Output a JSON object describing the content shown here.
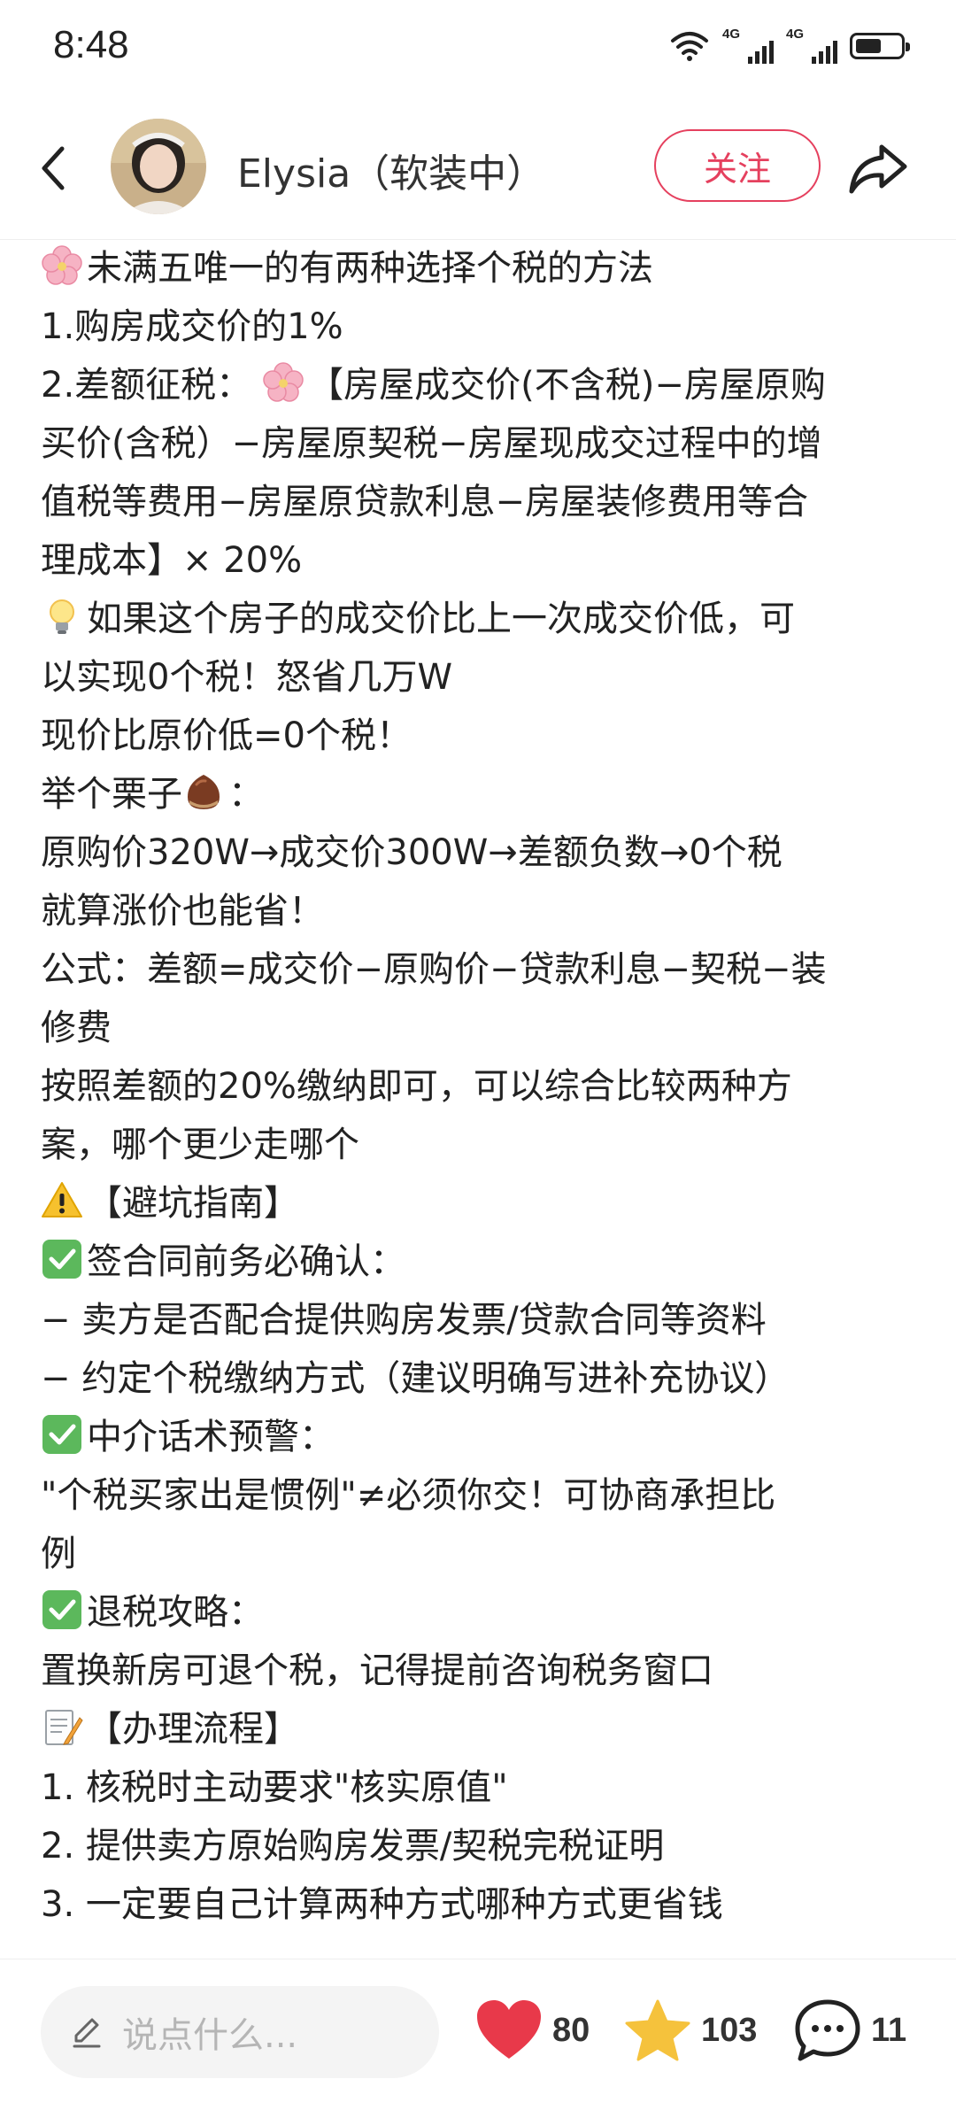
{
  "status_bar": {
    "time": "8:48",
    "signal_1": "4G",
    "signal_2": "4G"
  },
  "header": {
    "author_name": "Elysia（软装中）",
    "follow_label": "关注"
  },
  "content": {
    "lines": [
      "未满五唯一的有两种选择个税的方法",
      "1.购房成交价的1%",
      "2.差额征税：",
      "【房屋成交价(不含税)−房屋原购",
      "买价(含税）−房屋原契税−房屋现成交过程中的增",
      "值税等费用−房屋原贷款利息−房屋装修费用等合",
      "理成本】× 20%",
      "如果这个房子的成交价比上一次成交价低，可",
      "以实现0个税！怒省几万W",
      "现价比原价低=0个税！",
      "举个栗子",
      "：",
      "原购价320W→成交价300W→差额负数→0个税",
      "就算涨价也能省！",
      "公式：差额=成交价−原购价−贷款利息−契税−装",
      "修费",
      "按照差额的20%缴纳即可，可以综合比较两种方",
      "案，哪个更少走哪个",
      "【避坑指南】",
      "签合同前务必确认：",
      "− 卖方是否配合提供购房发票/贷款合同等资料",
      "− 约定个税缴纳方式（建议明确写进补充协议）",
      "中介话术预警：",
      "\"个税买家出是惯例\"≠必须你交！可协商承担比",
      "例",
      "退税攻略：",
      "置换新房可退个税，记得提前咨询税务窗口",
      "【办理流程】",
      "1. 核税时主动要求\"核实原值\"",
      "2. 提供卖方原始购房发票/契税完税证明",
      "3. 一定要自己计算两种方式哪种方式更省钱"
    ]
  },
  "bottom_bar": {
    "comment_placeholder": "说点什么...",
    "likes": "80",
    "collects": "103",
    "comments": "11"
  },
  "colors": {
    "accent": "#e5405e",
    "like_heart": "#e8394a",
    "collect_star": "#f5c23c"
  },
  "icons": [
    "back-arrow-icon",
    "share-icon",
    "flower-emoji-icon",
    "lightbulb-emoji-icon",
    "chestnut-emoji-icon",
    "warning-emoji-icon",
    "check-mark-emoji-icon",
    "memo-emoji-icon",
    "pen-icon",
    "heart-icon",
    "star-icon",
    "comment-bubble-icon"
  ]
}
